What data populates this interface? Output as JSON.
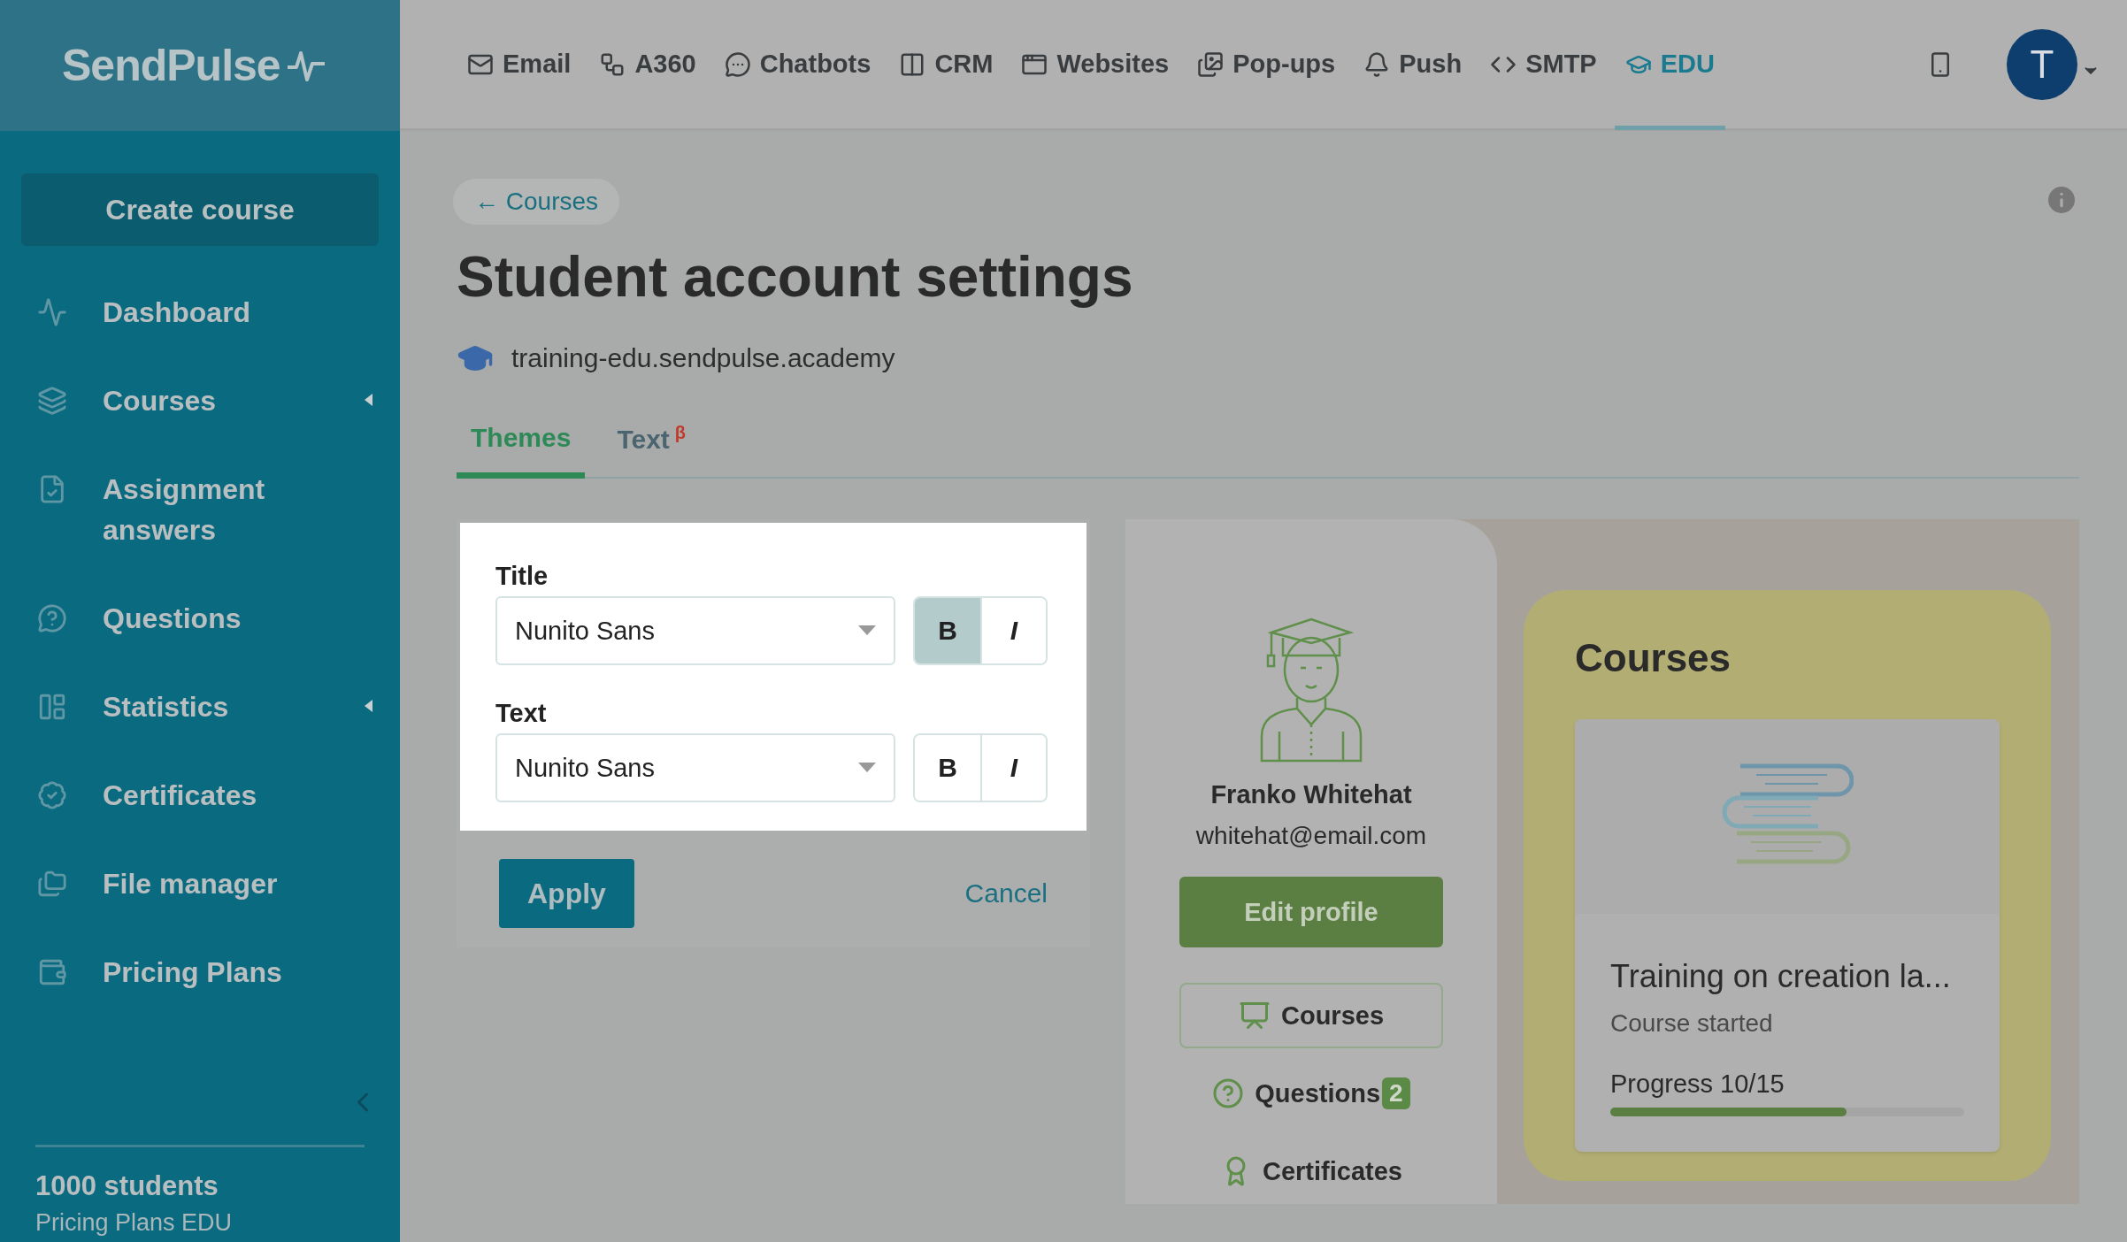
{
  "logo": {
    "text": "SendPulse"
  },
  "top_nav": [
    {
      "label": "Email",
      "selected": false
    },
    {
      "label": "A360",
      "selected": false
    },
    {
      "label": "Chatbots",
      "selected": false
    },
    {
      "label": "CRM",
      "selected": false
    },
    {
      "label": "Websites",
      "selected": false
    },
    {
      "label": "Pop-ups",
      "selected": false
    },
    {
      "label": "Push",
      "selected": false
    },
    {
      "label": "SMTP",
      "selected": false
    },
    {
      "label": "EDU",
      "selected": true
    }
  ],
  "user": {
    "initial": "T"
  },
  "sidebar": {
    "create_button": "Create course",
    "items": [
      {
        "label": "Dashboard",
        "expandable": false
      },
      {
        "label": "Courses",
        "expandable": true
      },
      {
        "label": "Assignment answers",
        "expandable": false
      },
      {
        "label": "Questions",
        "expandable": false
      },
      {
        "label": "Statistics",
        "expandable": true
      },
      {
        "label": "Certificates",
        "expandable": false
      },
      {
        "label": "File manager",
        "expandable": false
      },
      {
        "label": "Pricing Plans",
        "expandable": false
      }
    ],
    "plan_count": "1000 students",
    "plan_name": "Pricing Plans EDU"
  },
  "back_link": "← Courses",
  "page_title": "Student account settings",
  "domain": "training-edu.sendpulse.academy",
  "tabs": [
    {
      "label": "Themes",
      "selected": true
    },
    {
      "label": "Text",
      "badge": "β",
      "selected": false
    }
  ],
  "font_settings": [
    {
      "label": "Title",
      "value": "Nunito Sans",
      "bold": true,
      "italic": false,
      "bold_key": "B",
      "italic_key": "I"
    },
    {
      "label": "Text",
      "value": "Nunito Sans",
      "bold": false,
      "italic": false,
      "bold_key": "B",
      "italic_key": "I"
    }
  ],
  "apply_button": "Apply",
  "cancel_link": "Cancel",
  "profile": {
    "name": "Franko Whitehat",
    "email": "whitehat@email.com",
    "edit_button": "Edit profile",
    "menu": [
      {
        "label": "Courses",
        "selected": true
      },
      {
        "label": "Questions",
        "count": "2",
        "selected": false
      },
      {
        "label": "Certificates",
        "selected": false
      }
    ]
  },
  "courses_panel": {
    "title": "Courses",
    "course": {
      "name": "Training on creation la...",
      "status": "Course started",
      "progress_text": "Progress 10/15",
      "level": 0.667
    }
  }
}
